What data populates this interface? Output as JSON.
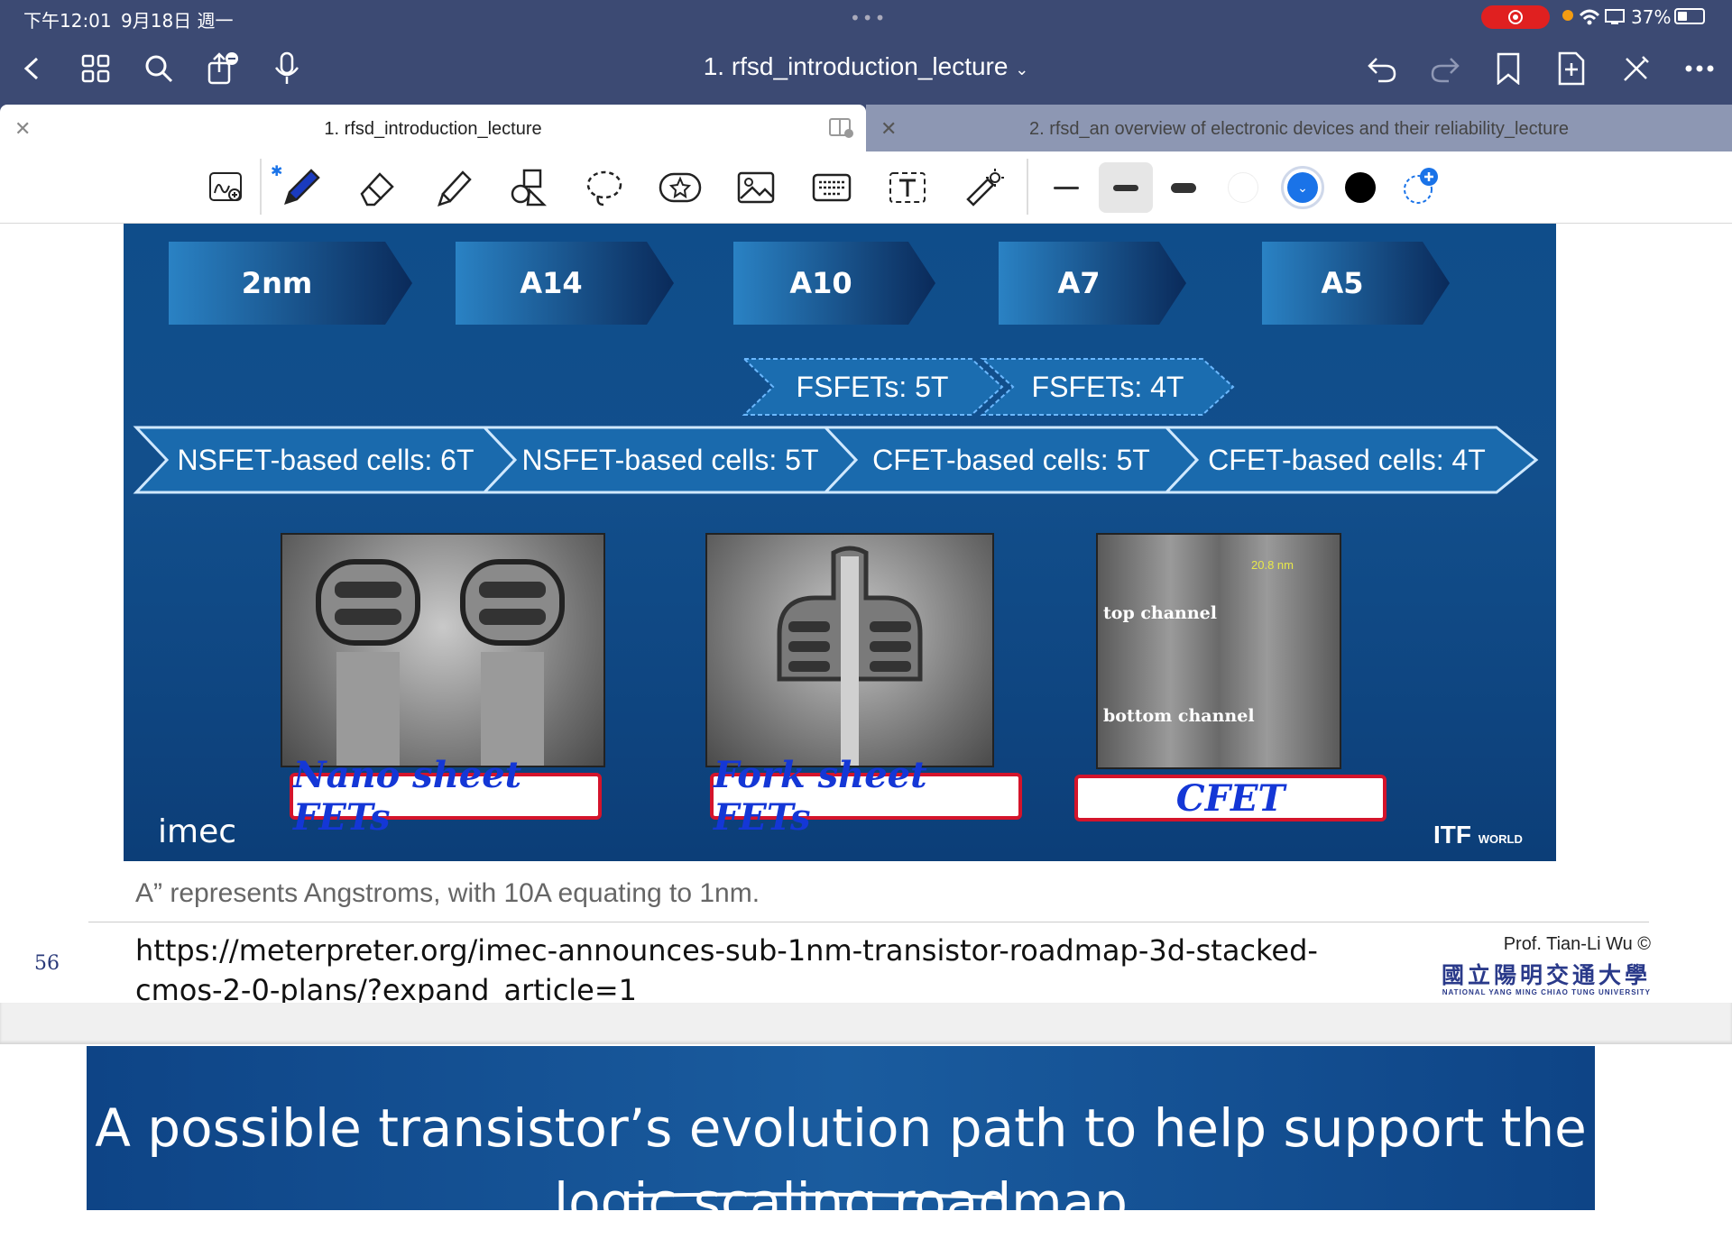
{
  "status_bar": {
    "time": "下午12:01",
    "date": "9月18日 週一",
    "battery": "37%"
  },
  "nav": {
    "doc_title": "1. rfsd_introduction_lecture"
  },
  "tabs": [
    {
      "label": "1. rfsd_introduction_lecture",
      "active": true
    },
    {
      "label": "2. rfsd_an overview of electronic devices and their reliability_lecture",
      "active": false
    }
  ],
  "toolbar": {
    "tools": [
      "lasso-handwriting-icon",
      "pen-icon",
      "eraser-icon",
      "highlighter-icon",
      "shapes-icon",
      "lasso-icon",
      "sticker-icon",
      "image-icon",
      "keyboard-icon",
      "text-icon",
      "laser-pointer-icon"
    ],
    "stroke_widths": [
      "thin",
      "medium",
      "thick"
    ],
    "colors": [
      "#ffffff",
      "#1a73e8",
      "#000000"
    ],
    "selected_color": "#1a73e8"
  },
  "slide": {
    "generations": [
      "2nm",
      "A14",
      "A10",
      "A7",
      "A5"
    ],
    "fsfets": [
      "FSFETs: 5T",
      "FSFETs: 4T"
    ],
    "cells": [
      "NSFET-based cells: 6T",
      "NSFET-based cells: 5T",
      "CFET-based cells: 5T",
      "CFET-based cells: 4T"
    ],
    "tem_labels": {
      "top": "top channel",
      "bottom": "bottom channel",
      "scale": "20.8 nm"
    },
    "handwritten_captions": [
      "Nano sheet FETs",
      "Fork sheet FETs",
      "CFET"
    ],
    "logo_left": "imec",
    "logo_right": "ITF",
    "logo_right_sub": "WORLD"
  },
  "note": "A” represents Angstroms, with 10A equating to 1nm.",
  "page_number": "56",
  "url": "https://meterpreter.org/imec-announces-sub-1nm-transistor-roadmap-3d-stacked-cmos-2-0-plans/?expand_article=1",
  "credit": "Prof. Tian-Li Wu ©",
  "university_cn": "國立陽明交通大學",
  "university_en": "NATIONAL YANG MING CHIAO TUNG UNIVERSITY",
  "next_slide": {
    "title": "A possible transistor’s evolution path to help support the logic scaling roadmap"
  }
}
